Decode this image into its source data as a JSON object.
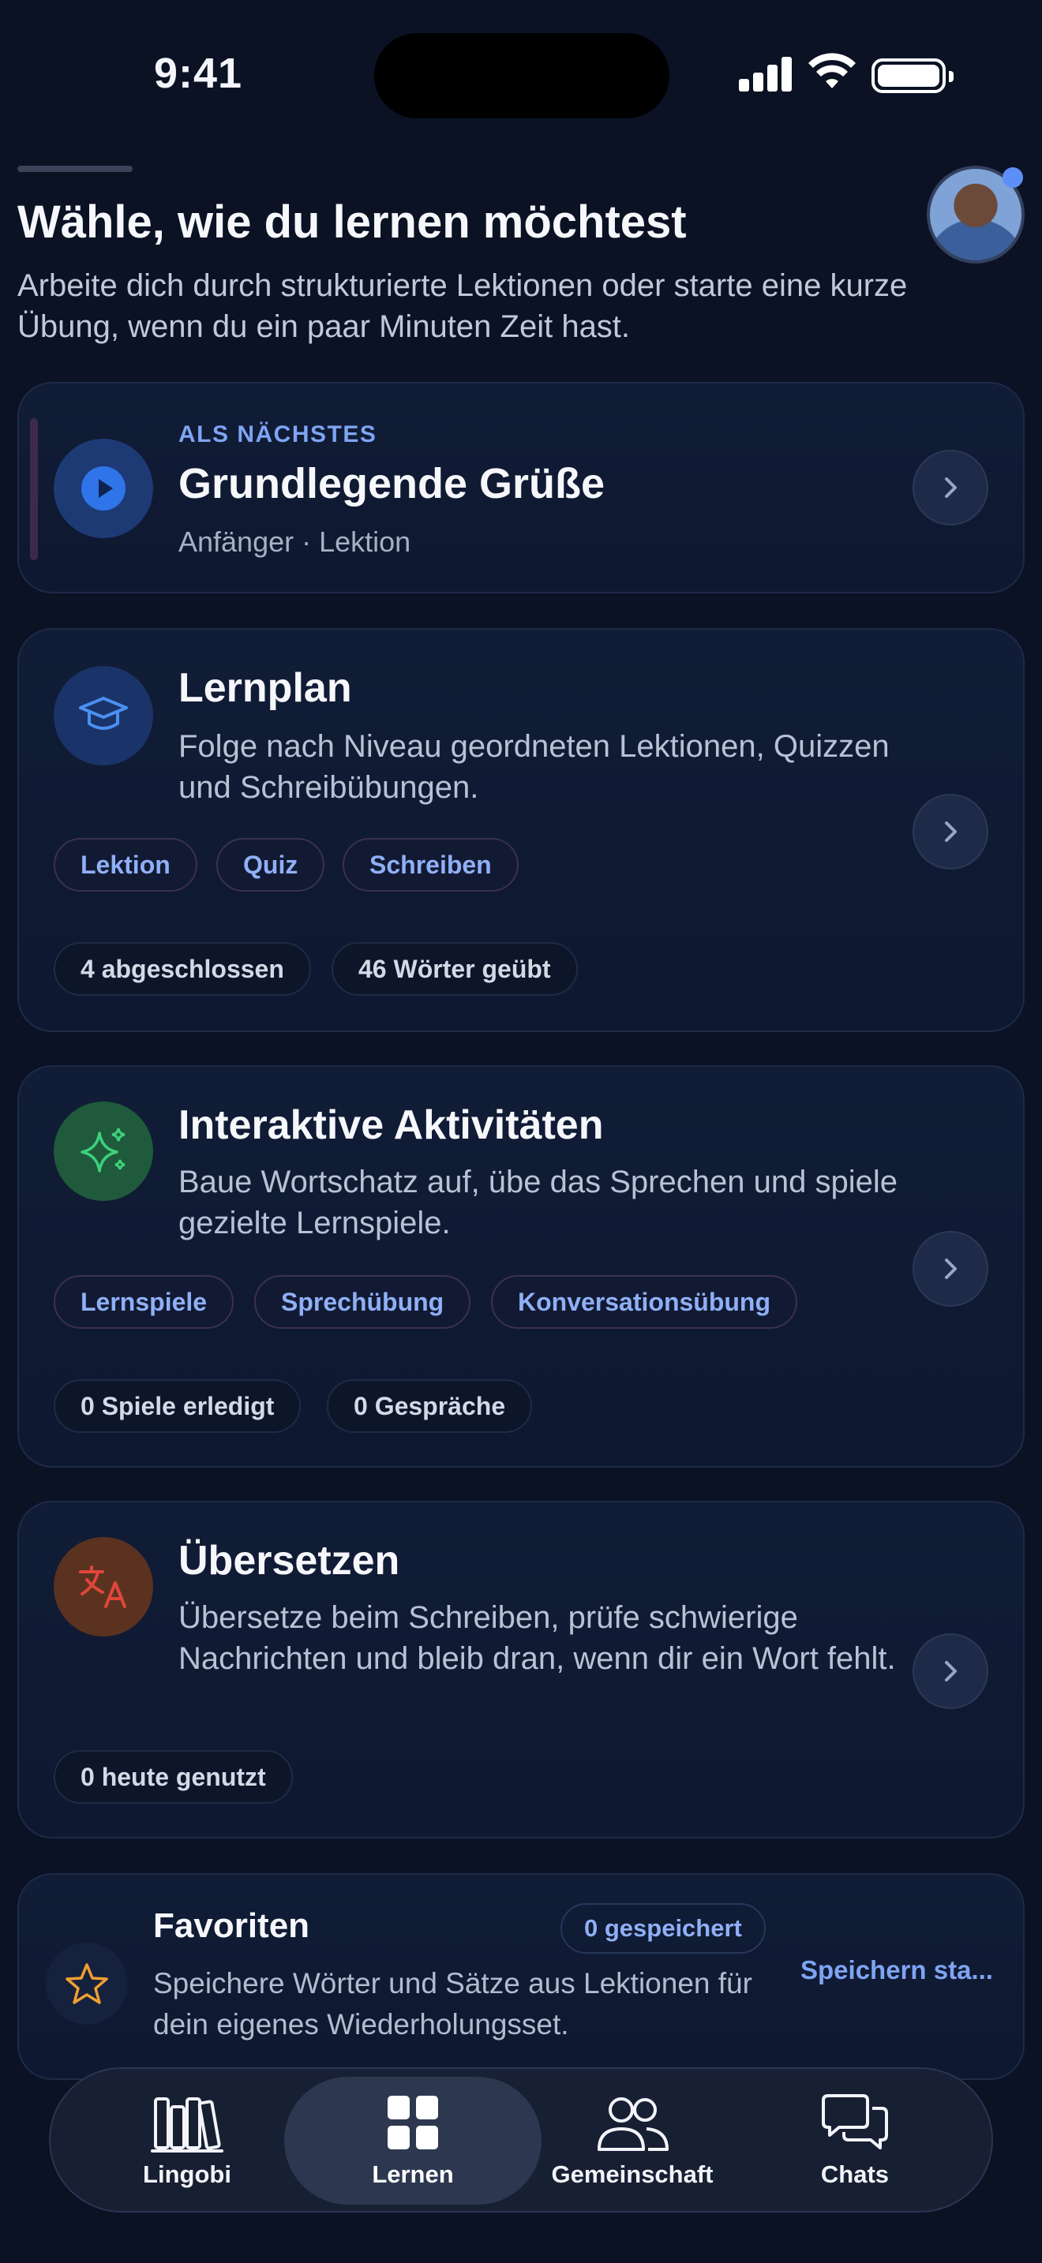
{
  "status_bar": {
    "time": "9:41"
  },
  "header": {
    "title": "Wähle, wie du lernen möchtest",
    "subtitle": "Arbeite dich durch strukturierte Lektionen oder starte eine kurze Übung, wenn du ein paar Minuten Zeit hast."
  },
  "next_up": {
    "eyebrow": "ALS NÄCHSTES",
    "title": "Grundlegende Grüße",
    "meta": "Anfänger · Lektion"
  },
  "cards": {
    "learning_plan": {
      "title": "Lernplan",
      "description": "Folge nach Niveau geordneten Lektionen, Quizzen und Schreibübungen.",
      "tags": [
        "Lektion",
        "Quiz",
        "Schreiben"
      ],
      "stats": [
        "4 abgeschlossen",
        "46 Wörter geübt"
      ]
    },
    "activities": {
      "title": "Interaktive Aktivitäten",
      "description": "Baue Wortschatz auf, übe das Sprechen und spiele gezielte Lernspiele.",
      "tags": [
        "Lernspiele",
        "Sprechübung",
        "Konversationsübung"
      ],
      "stats": [
        "0 Spiele erledigt",
        "0 Gespräche"
      ]
    },
    "translate": {
      "title": "Übersetzen",
      "description": "Übersetze beim Schreiben, prüfe schwierige Nachrichten und bleib dran, wenn dir ein Wort fehlt.",
      "stats": [
        "0 heute genutzt"
      ]
    }
  },
  "favorites": {
    "title": "Favoriten",
    "badge": "0 gespeichert",
    "description": "Speichere Wörter und Sätze aus Lektionen für dein eigenes Wiederholungsset.",
    "link": "Speichern sta..."
  },
  "tab_bar": {
    "tabs": [
      {
        "label": "Lingobi",
        "icon": "library-icon"
      },
      {
        "label": "Lernen",
        "icon": "grid-icon",
        "active": true
      },
      {
        "label": "Gemeinschaft",
        "icon": "people-icon"
      },
      {
        "label": "Chats",
        "icon": "chat-bubbles-icon"
      }
    ]
  },
  "colors": {
    "background": "#0a1224",
    "accent_blue": "#7ea4f3",
    "green_icon": "#3fbf6a",
    "translate_red": "#d94a3a",
    "star_orange": "#f0a030"
  }
}
